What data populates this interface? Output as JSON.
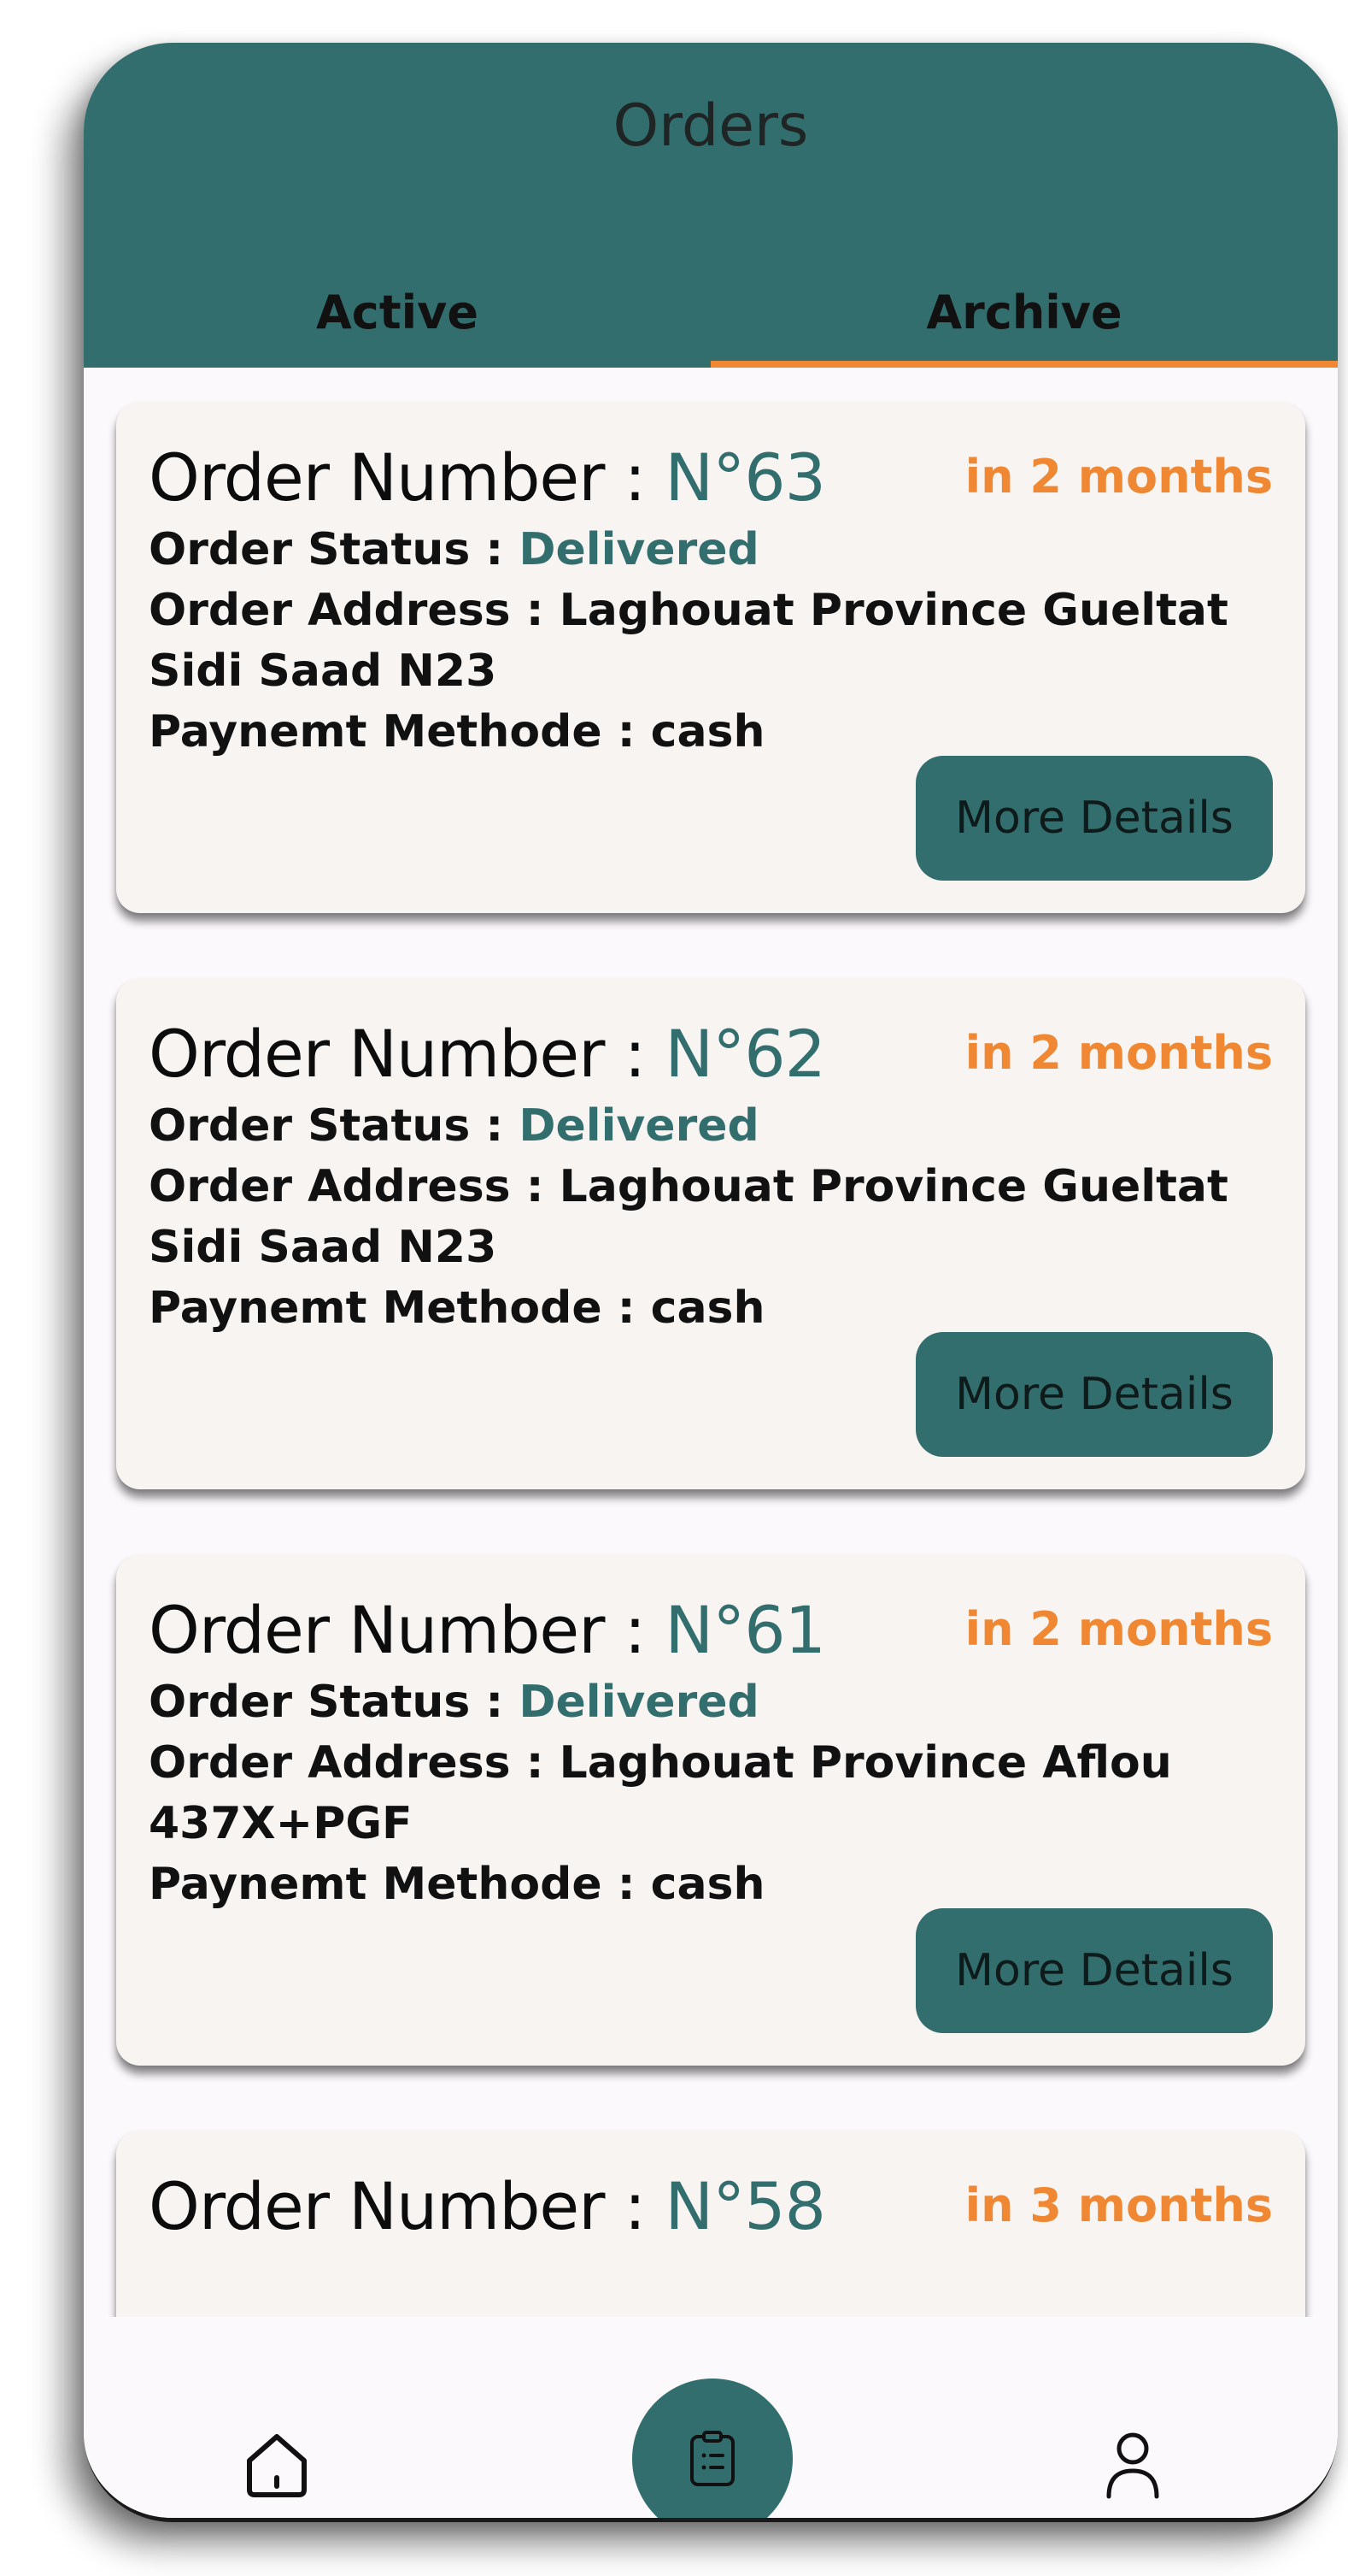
{
  "header": {
    "title": "Orders",
    "tabs": [
      {
        "label": "Active",
        "selected": false
      },
      {
        "label": "Archive",
        "selected": true
      }
    ]
  },
  "colors": {
    "primary": "#336e6e",
    "accent": "#ef8733",
    "card_bg": "#f7f4f2",
    "page_bg": "#fcf9fc"
  },
  "labels": {
    "order_number": "Order Number : ",
    "order_status": "Order Status : ",
    "order_address": "Order Address : ",
    "payment_method": "Paynemt Methode : ",
    "more_details": "More Details"
  },
  "orders": [
    {
      "number": "N°63",
      "time": "in 2 months",
      "status": "Delivered",
      "address": "Laghouat Province Gueltat Sidi Saad N23",
      "payment": "cash"
    },
    {
      "number": "N°62",
      "time": "in 2 months",
      "status": "Delivered",
      "address": "Laghouat Province Gueltat Sidi Saad N23",
      "payment": "cash"
    },
    {
      "number": "N°61",
      "time": "in 2 months",
      "status": "Delivered",
      "address": "Laghouat Province Aflou 437X+PGF",
      "payment": "cash"
    },
    {
      "number": "N°58",
      "time": "in 3 months",
      "status": "",
      "address": "",
      "payment": ""
    }
  ],
  "bottom_nav": {
    "items": [
      {
        "icon": "home-icon",
        "selected": false
      },
      {
        "icon": "clipboard-list-icon",
        "selected": true
      },
      {
        "icon": "user-icon",
        "selected": false
      }
    ]
  }
}
